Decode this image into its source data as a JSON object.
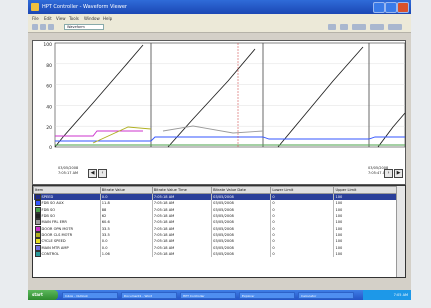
{
  "window": {
    "title": "HPT Controller - Waveform Viewer",
    "tab_label": "Waveform"
  },
  "menubar": {
    "items": [
      "File",
      "Edit",
      "View",
      "Tools",
      "Window",
      "Help"
    ]
  },
  "plot": {
    "y_ticks": [
      "100",
      "80",
      "60",
      "40",
      "20",
      "0"
    ],
    "start_time": "03/05/2008",
    "start_clock": "7:05:17 AM",
    "end_time": "03/05/2008",
    "end_clock": "7:05:47 AM"
  },
  "table": {
    "headers": [
      "Item",
      "Bitrate Value",
      "Bitrate Value Time",
      "Bitrate Value Date",
      "Lower Limit",
      "Upper Limit"
    ],
    "rows": [
      {
        "color": "#1f2a8a",
        "item": "SPEED",
        "value": "0.0",
        "time": "7:05:18 AM",
        "date": "03/05/2008",
        "lower": "0",
        "upper": "100",
        "selected": true
      },
      {
        "color": "#3355ff",
        "item": "FDB SO AUX",
        "value": "11.8",
        "time": "7:05:18 AM",
        "date": "03/05/2008",
        "lower": "0",
        "upper": "100",
        "selected": false
      },
      {
        "color": "#4aa04a",
        "item": "FDB SO",
        "value": "88",
        "time": "7:05:18 AM",
        "date": "03/05/2008",
        "lower": "0",
        "upper": "100",
        "selected": false
      },
      {
        "color": "#222222",
        "item": "FDB SO",
        "value": "62",
        "time": "7:05:18 AM",
        "date": "03/05/2008",
        "lower": "0",
        "upper": "100",
        "selected": false
      },
      {
        "color": "#9a9a9a",
        "item": "MAIN FRL ERR",
        "value": "60.6",
        "time": "7:05:18 AM",
        "date": "03/05/2008",
        "lower": "0",
        "upper": "100",
        "selected": false
      },
      {
        "color": "#cc33cc",
        "item": "DOOR OPN MOTR",
        "value": "33.5",
        "time": "7:05:18 AM",
        "date": "03/05/2008",
        "lower": "0",
        "upper": "100",
        "selected": false
      },
      {
        "color": "#b0b020",
        "item": "DOOR CLS MOTR",
        "value": "33.5",
        "time": "7:05:18 AM",
        "date": "03/05/2008",
        "lower": "0",
        "upper": "100",
        "selected": false
      },
      {
        "color": "#e8e020",
        "item": "CYCLE SPEED",
        "value": "0.0",
        "time": "7:05:18 AM",
        "date": "03/05/2008",
        "lower": "0",
        "upper": "100",
        "selected": false
      },
      {
        "color": "#7070e0",
        "item": "MAIN MTR AMP",
        "value": "0.0",
        "time": "7:05:18 AM",
        "date": "03/05/2008",
        "lower": "0",
        "upper": "100",
        "selected": false
      },
      {
        "color": "#2a9a9a",
        "item": "CONTROL",
        "value": "1.06",
        "time": "7:05:18 AM",
        "date": "03/05/2008",
        "lower": "0",
        "upper": "100",
        "selected": false
      }
    ]
  },
  "taskbar": {
    "start_label": "start",
    "tasks": [
      "Inbox - Outlook",
      "Document1 - Word",
      "HPT Controller",
      "Explorer",
      "Calculator"
    ],
    "clock": "7:05 AM"
  },
  "icons": {
    "nav_left": "arrow-left-icon",
    "nav_right": "arrow-right-icon"
  }
}
